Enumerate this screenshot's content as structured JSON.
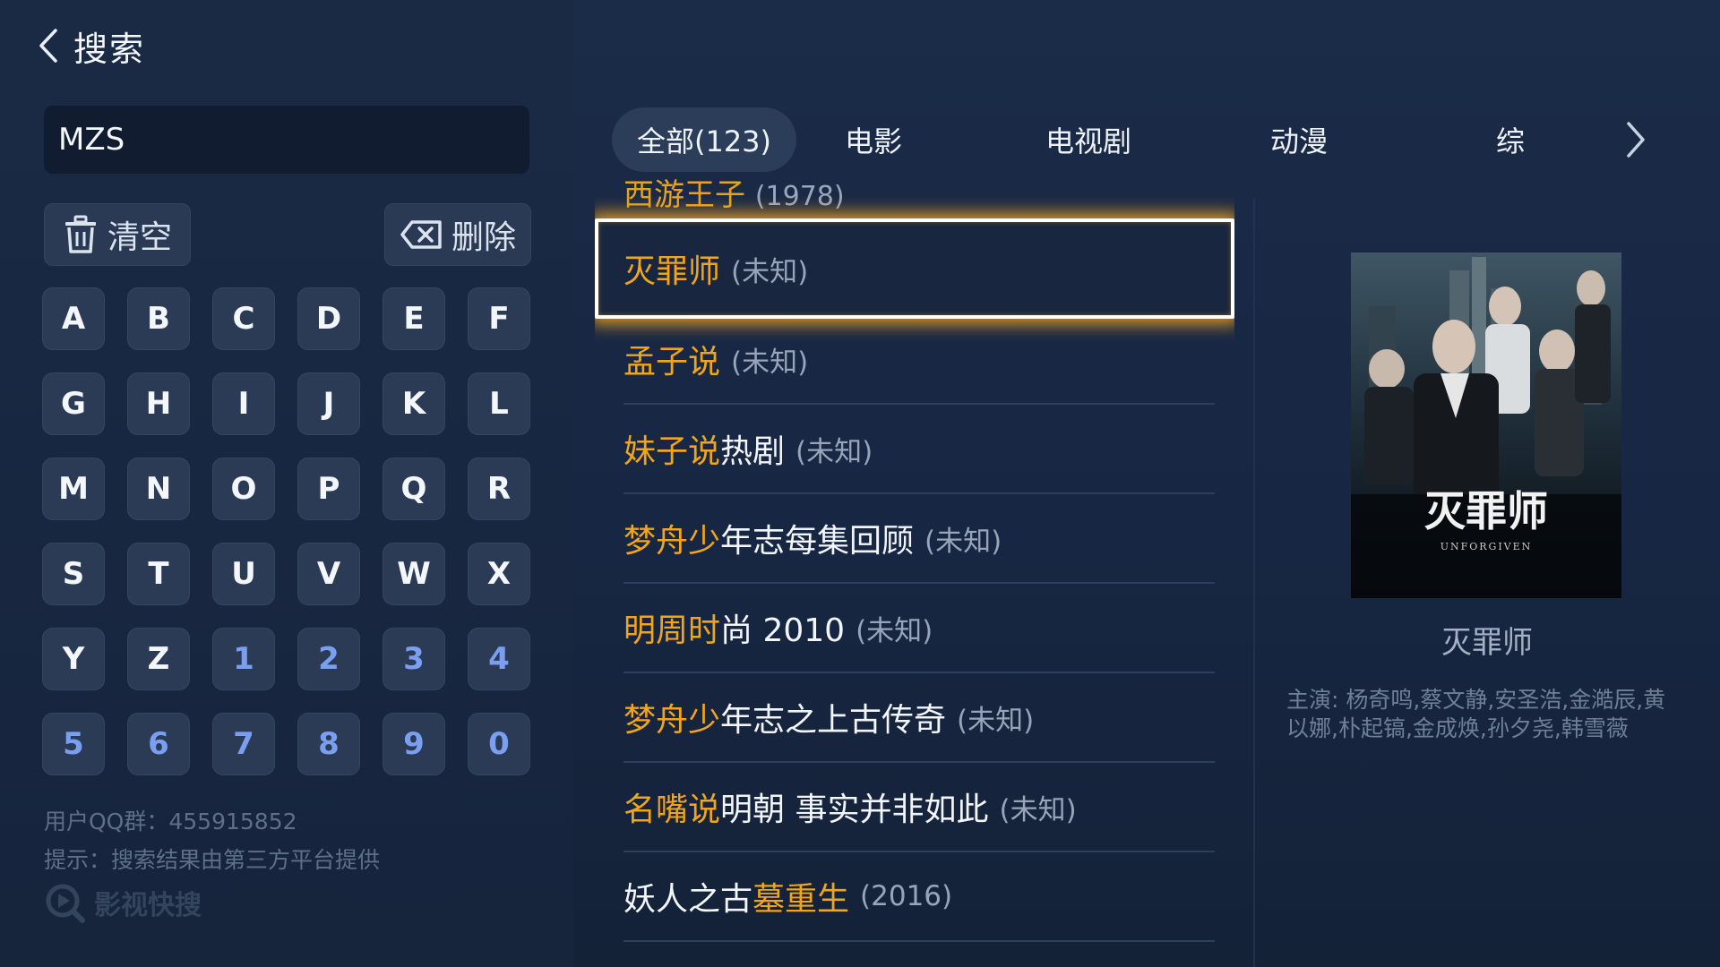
{
  "header": {
    "title": "搜索"
  },
  "search": {
    "value": "MZS"
  },
  "actions": {
    "clear_label": "清空",
    "delete_label": "删除"
  },
  "keypad": {
    "keys": [
      "A",
      "B",
      "C",
      "D",
      "E",
      "F",
      "G",
      "H",
      "I",
      "J",
      "K",
      "L",
      "M",
      "N",
      "O",
      "P",
      "Q",
      "R",
      "S",
      "T",
      "U",
      "V",
      "W",
      "X",
      "Y",
      "Z",
      "1",
      "2",
      "3",
      "4",
      "5",
      "6",
      "7",
      "8",
      "9",
      "0"
    ]
  },
  "footer": {
    "qq_group": "用户QQ群：455915852",
    "hint": "提示：搜索结果由第三方平台提供",
    "brand": "影视快搜"
  },
  "tabs": [
    {
      "label": "全部(123)",
      "active": true
    },
    {
      "label": "电影",
      "active": false
    },
    {
      "label": "电视剧",
      "active": false
    },
    {
      "label": "动漫",
      "active": false
    },
    {
      "label": "综",
      "active": false
    }
  ],
  "results": {
    "cut_off_row": {
      "highlight": "西游王子",
      "meta": "(1978)"
    },
    "items": [
      {
        "highlight": "灭罪师",
        "rest": "",
        "meta": "(未知)",
        "focused": true
      },
      {
        "highlight": "孟子说",
        "rest": "",
        "meta": "(未知)"
      },
      {
        "highlight": "妹子说",
        "rest": "热剧",
        "meta": "(未知)"
      },
      {
        "highlight": "梦舟少",
        "rest": "年志每集回顾",
        "meta": "(未知)"
      },
      {
        "highlight": "明周时",
        "rest": "尚 2010",
        "meta": "(未知)"
      },
      {
        "highlight": "梦舟少",
        "rest": "年志之上古传奇",
        "meta": "(未知)"
      },
      {
        "highlight": "名嘴说",
        "rest": "明朝 事实并非如此",
        "meta": "(未知)"
      },
      {
        "prefix": "妖人之古",
        "highlight": "墓重生",
        "meta": "(2016)"
      }
    ]
  },
  "detail": {
    "poster_title": "灭罪师",
    "poster_subtitle": "UNFORGIVEN",
    "title": "灭罪师",
    "cast": "主演:   杨奇鸣,蔡文静,安圣浩,金澔辰,黄以娜,朴起镐,金成焕,孙夕尧,韩雪薇"
  },
  "colors": {
    "highlight": "#f0a51a",
    "focus_glow": "#ffaa1e",
    "background": "#172642"
  }
}
